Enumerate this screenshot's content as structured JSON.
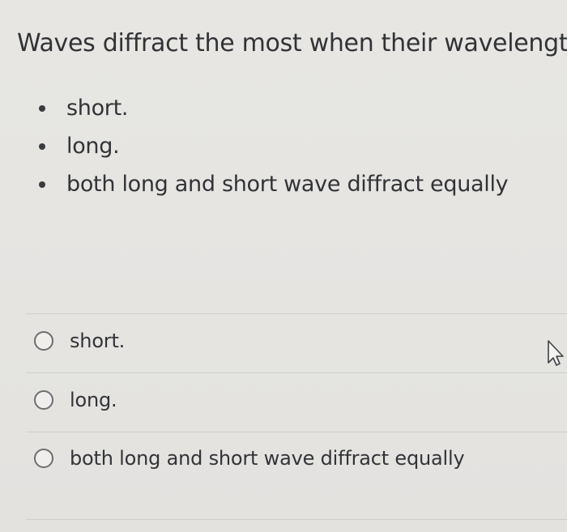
{
  "question": {
    "text": "Waves diffract the most when their wavelength is"
  },
  "bullets": [
    {
      "label": "short."
    },
    {
      "label": "long."
    },
    {
      "label": "both long and short wave diffract equally"
    }
  ],
  "options": [
    {
      "label": "short."
    },
    {
      "label": "long."
    },
    {
      "label": "both long and short wave diffract equally"
    }
  ],
  "icons": {
    "radio": "radio-button-icon",
    "cursor": "hand-pointer-cursor-icon"
  }
}
